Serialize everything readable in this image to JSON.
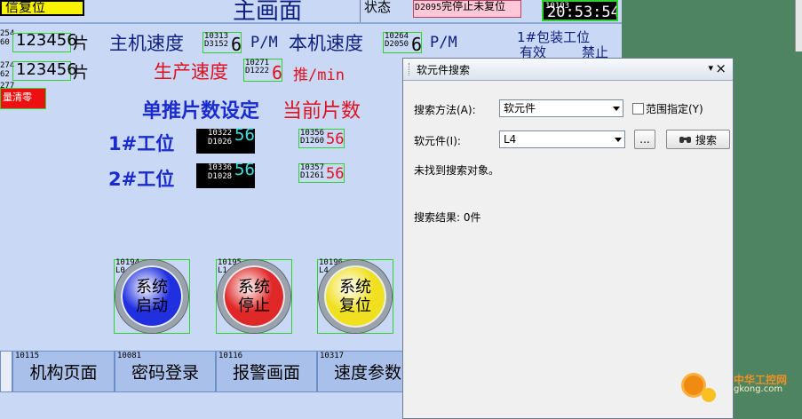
{
  "hmi": {
    "top_left_text": "信复位",
    "title": "主画面",
    "status_label": "状态",
    "status_value": "D2095",
    "status_text": "完停止未复位",
    "clock_tag": "10103",
    "clock": "20:53:54",
    "row1": {
      "tag_a": "254",
      "tag_b": "60",
      "count": "123456",
      "count_unit": "片",
      "main_speed_label": "主机速度",
      "main_tag_top": "10313",
      "main_tag": "D3152",
      "main_val": "6",
      "main_unit": "P/M",
      "local_speed_label": "本机速度",
      "local_tag_top": "10264",
      "local_tag": "D2050",
      "local_val": "6",
      "local_unit": "P/M",
      "pack_label": "1#包装工位"
    },
    "row2": {
      "tag_a": "274",
      "tag_b": "62",
      "count": "123456",
      "count_unit": "片",
      "prod_label": "生产速度",
      "prod_tag_top": "10271",
      "prod_tag": "D1222",
      "prod_val": "6",
      "prod_unit": "推/min",
      "valid": "有效",
      "forbid": "禁止",
      "clear_tag": "277",
      "clear_label": "量清零"
    },
    "settings": {
      "set_label": "单推片数设定",
      "current_label": "当前片数",
      "st1": "1#工位",
      "st1_set_top": "10322",
      "st1_set_tag": "D1026",
      "st1_set_val": "56",
      "st1_cur_top": "10356",
      "st1_cur_tag": "D1260",
      "st1_cur_val": "56",
      "st2": "2#工位",
      "st2_set_top": "10336",
      "st2_set_tag": "D1028",
      "st2_set_val": "56",
      "st2_cur_top": "10357",
      "st2_cur_tag": "D1261",
      "st2_cur_val": "56"
    },
    "buttons": [
      {
        "tag": "10194",
        "sub": "L0",
        "line1": "系统",
        "line2": "启动",
        "color": "#2030e0"
      },
      {
        "tag": "10195",
        "sub": "L1",
        "line1": "系统",
        "line2": "停止",
        "color": "#e02828"
      },
      {
        "tag": "10196",
        "sub": "L4",
        "line1": "系统",
        "line2": "复位",
        "color": "#f0e020"
      }
    ],
    "nav": [
      {
        "tag": "10115",
        "label": "机构页面"
      },
      {
        "tag": "10081",
        "label": "密码登录"
      },
      {
        "tag": "10116",
        "label": "报警画面"
      },
      {
        "tag": "10317",
        "label": "速度参数"
      }
    ]
  },
  "panel": {
    "title": "软元件搜索",
    "pin": "▾",
    "close": "×",
    "method_label": "搜索方法(A):",
    "method_value": "软元件",
    "range_label": "范围指定(Y)",
    "device_label": "软元件(I):",
    "device_value": "L4",
    "browse_label": "...",
    "search_label": "搜索",
    "not_found": "未找到搜索对象。",
    "result_label": "搜索结果: 0件"
  },
  "watermark": {
    "text1": "中华工控网",
    "text2": "gkong.com"
  }
}
